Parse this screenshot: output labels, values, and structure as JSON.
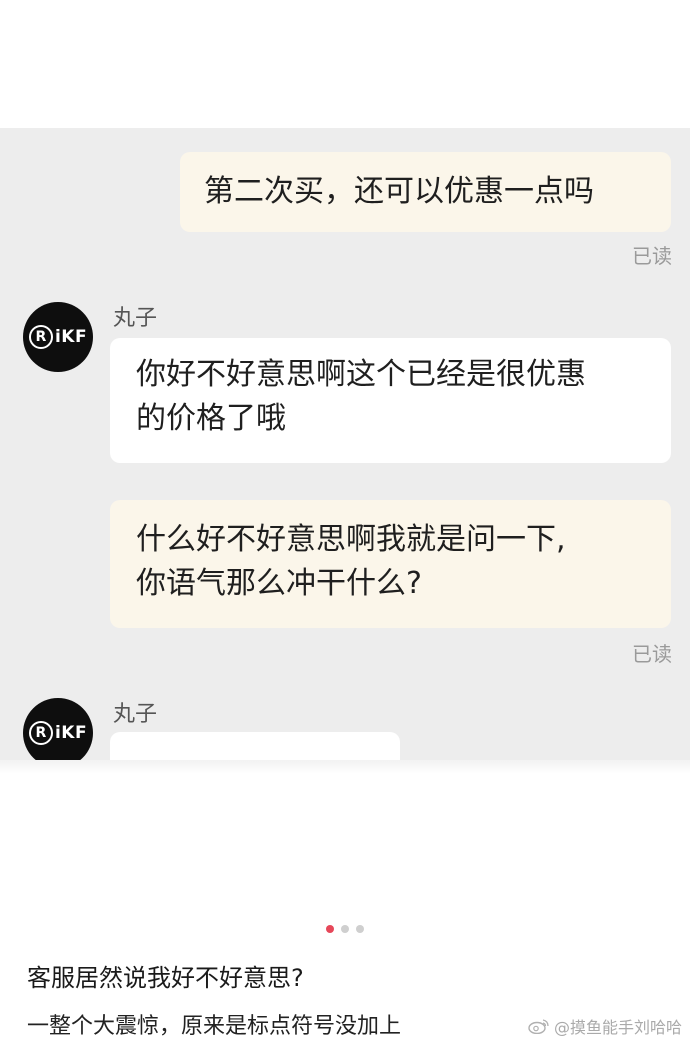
{
  "messages": [
    {
      "from": "me",
      "text": "第二次买，还可以优惠一点吗",
      "status": "已读"
    },
    {
      "from": "shop",
      "sender": "丸子",
      "text_line1": "你好不好意思啊这个已经是很优惠",
      "text_line2": "的价格了哦"
    },
    {
      "from": "me",
      "text_line1": "什么好不好意思啊我就是问一下,",
      "text_line2": "你语气那么冲干什么?",
      "status": "已读"
    },
    {
      "from": "shop",
      "sender": "丸子"
    }
  ],
  "avatar": {
    "ring_letter": "R",
    "text": "iKF"
  },
  "carousel": {
    "total": 3,
    "active_index": 0,
    "active_color": "#e64759"
  },
  "caption": {
    "title": "客服居然说我好不好意思?",
    "subtitle": "一整个大震惊，原来是标点符号没加上"
  },
  "watermark": {
    "text": "@摸鱼能手刘哈哈",
    "icon": "weibo-icon"
  }
}
